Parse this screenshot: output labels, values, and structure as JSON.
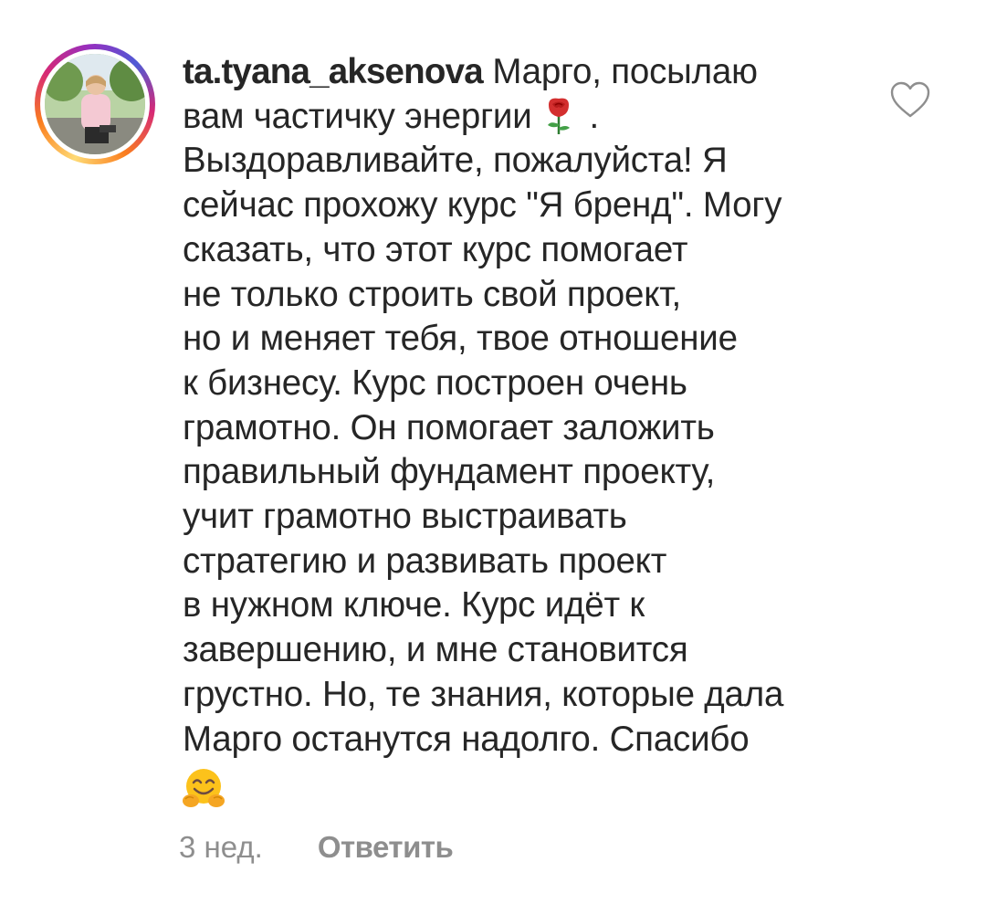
{
  "comment": {
    "username": "ta.tyana_aksenova",
    "text_lines": [
      " Марго, посылаю",
      "вам частичку энергии ",
      "Выздоравливайте, пожалуйста! Я",
      "сейчас прохожу курс \"Я бренд\". Могу",
      "сказать, что этот курс помогает",
      "не только строить свой проект,",
      "но и меняет тебя, твое отношение",
      "к бизнесу. Курс построен очень",
      "грамотно. Он помогает  заложить",
      "правильный фундамент проекту,",
      "учит грамотно выстраивать",
      "стратегию и развивать проект",
      "в нужном ключе. Курс идёт к",
      "завершению, и мне становится",
      "грустно. Но, те знания, которые дала",
      "Марго останутся надолго. Спасибо"
    ],
    "after_rose": " .",
    "emojis": [
      "rose-emoji",
      "hugging-face-emoji"
    ],
    "timestamp": "3 нед.",
    "reply_label": "Ответить",
    "like_icon": "heart-outline-icon"
  },
  "colors": {
    "text": "#262626",
    "secondary_text": "#8e8e8e",
    "story_ring_gradient": [
      "#feda75",
      "#fa7e1e",
      "#d62976",
      "#962fbf",
      "#4f5bd5"
    ]
  }
}
